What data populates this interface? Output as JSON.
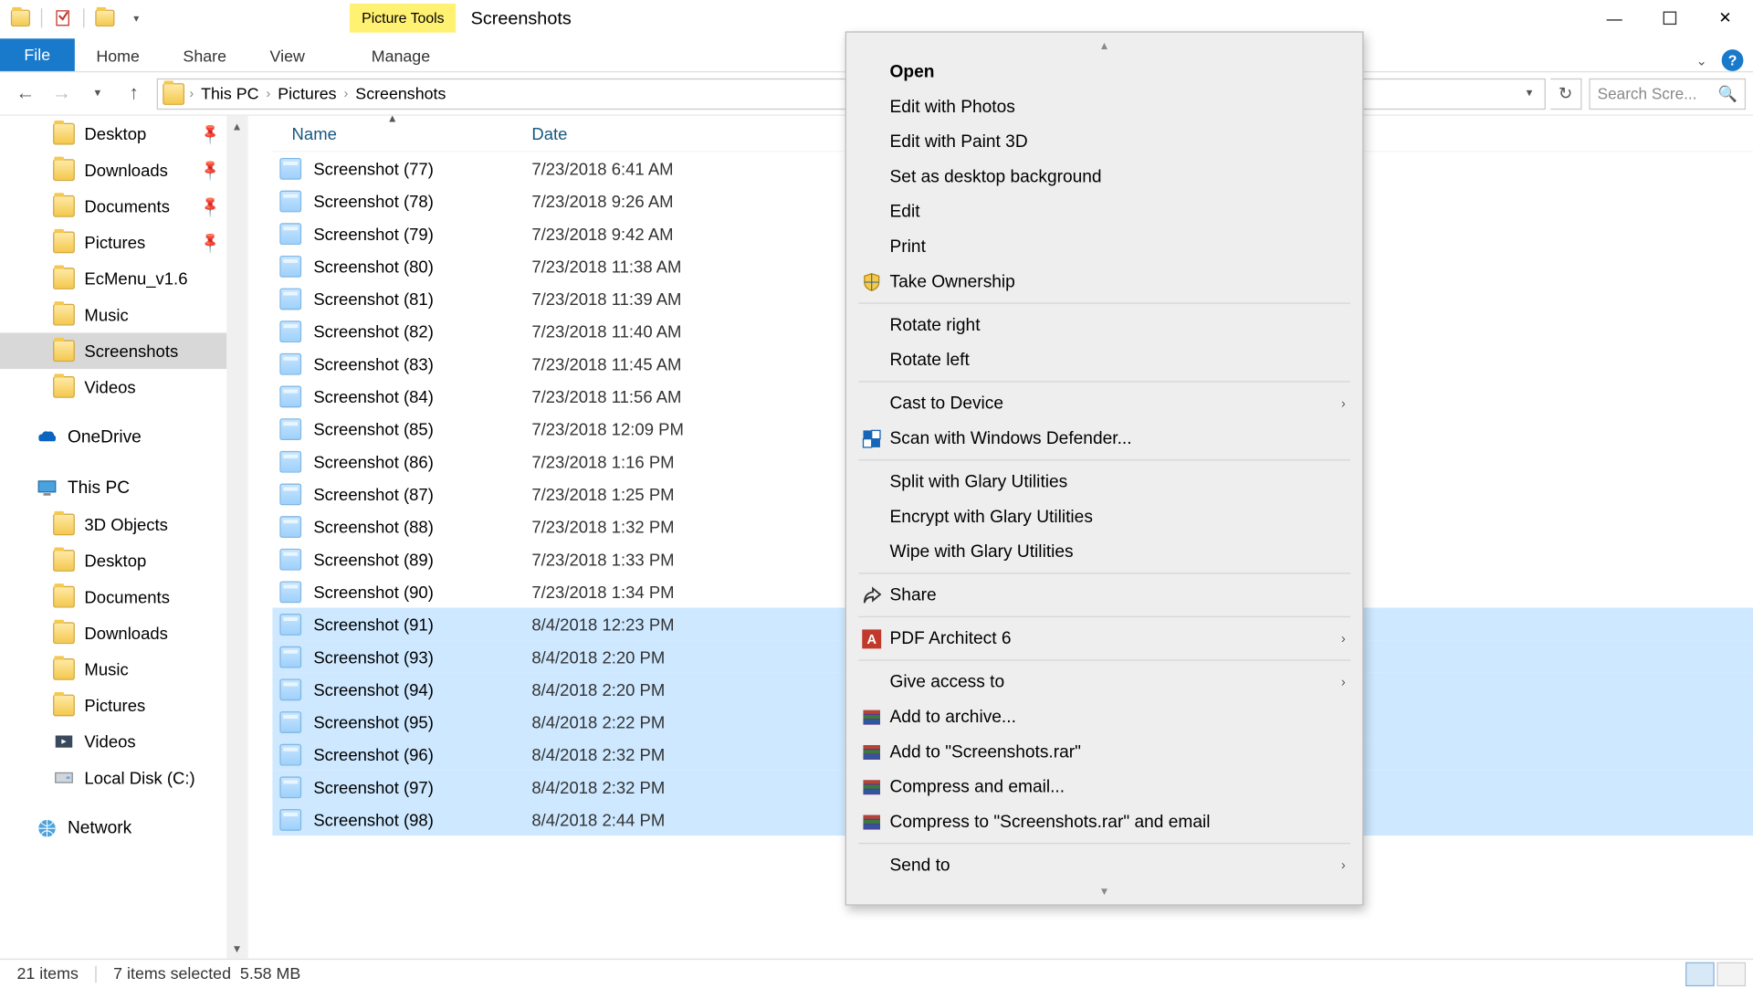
{
  "titlebar": {
    "contextual_tab": "Picture Tools",
    "title": "Screenshots"
  },
  "window_controls": {
    "min": "—",
    "max": "□",
    "close": "✕"
  },
  "ribbon": {
    "file": "File",
    "tabs": [
      "Home",
      "Share",
      "View"
    ],
    "contextual": "Manage"
  },
  "nav": {
    "back": "←",
    "forward": "→",
    "up": "↑",
    "breadcrumbs": [
      "This PC",
      "Pictures",
      "Screenshots"
    ]
  },
  "search": {
    "placeholder": "Search Scre..."
  },
  "sidebar": {
    "quick": [
      {
        "label": "Desktop",
        "pinned": true
      },
      {
        "label": "Downloads",
        "pinned": true
      },
      {
        "label": "Documents",
        "pinned": true
      },
      {
        "label": "Pictures",
        "pinned": true
      },
      {
        "label": "EcMenu_v1.6",
        "pinned": false
      },
      {
        "label": "Music",
        "pinned": false
      },
      {
        "label": "Screenshots",
        "pinned": false,
        "selected": true
      },
      {
        "label": "Videos",
        "pinned": false
      }
    ],
    "onedrive": "OneDrive",
    "thispc": "This PC",
    "thispc_items": [
      "3D Objects",
      "Desktop",
      "Documents",
      "Downloads",
      "Music",
      "Pictures",
      "Videos",
      "Local Disk (C:)"
    ],
    "network": "Network"
  },
  "columns": {
    "name": "Name",
    "date": "Date"
  },
  "files": [
    {
      "name": "Screenshot (77)",
      "date": "7/23/2018 6:41 AM",
      "selected": false
    },
    {
      "name": "Screenshot (78)",
      "date": "7/23/2018 9:26 AM",
      "selected": false
    },
    {
      "name": "Screenshot (79)",
      "date": "7/23/2018 9:42 AM",
      "selected": false
    },
    {
      "name": "Screenshot (80)",
      "date": "7/23/2018 11:38 AM",
      "selected": false
    },
    {
      "name": "Screenshot (81)",
      "date": "7/23/2018 11:39 AM",
      "selected": false
    },
    {
      "name": "Screenshot (82)",
      "date": "7/23/2018 11:40 AM",
      "selected": false
    },
    {
      "name": "Screenshot (83)",
      "date": "7/23/2018 11:45 AM",
      "selected": false
    },
    {
      "name": "Screenshot (84)",
      "date": "7/23/2018 11:56 AM",
      "selected": false
    },
    {
      "name": "Screenshot (85)",
      "date": "7/23/2018 12:09 PM",
      "selected": false
    },
    {
      "name": "Screenshot (86)",
      "date": "7/23/2018 1:16 PM",
      "selected": false
    },
    {
      "name": "Screenshot (87)",
      "date": "7/23/2018 1:25 PM",
      "selected": false
    },
    {
      "name": "Screenshot (88)",
      "date": "7/23/2018 1:32 PM",
      "selected": false
    },
    {
      "name": "Screenshot (89)",
      "date": "7/23/2018 1:33 PM",
      "selected": false
    },
    {
      "name": "Screenshot (90)",
      "date": "7/23/2018 1:34 PM",
      "selected": false
    },
    {
      "name": "Screenshot (91)",
      "date": "8/4/2018 12:23 PM",
      "selected": true
    },
    {
      "name": "Screenshot (93)",
      "date": "8/4/2018 2:20 PM",
      "selected": true
    },
    {
      "name": "Screenshot (94)",
      "date": "8/4/2018 2:20 PM",
      "selected": true
    },
    {
      "name": "Screenshot (95)",
      "date": "8/4/2018 2:22 PM",
      "selected": true
    },
    {
      "name": "Screenshot (96)",
      "date": "8/4/2018 2:32 PM",
      "selected": true
    },
    {
      "name": "Screenshot (97)",
      "date": "8/4/2018 2:32 PM",
      "selected": true
    },
    {
      "name": "Screenshot (98)",
      "date": "8/4/2018 2:44 PM",
      "selected": true
    }
  ],
  "context_menu": [
    {
      "label": "Open",
      "bold": true
    },
    {
      "label": "Edit with Photos"
    },
    {
      "label": "Edit with Paint 3D"
    },
    {
      "label": "Set as desktop background"
    },
    {
      "label": "Edit"
    },
    {
      "label": "Print"
    },
    {
      "label": "Take Ownership",
      "icon": "shield"
    },
    {
      "sep": true
    },
    {
      "label": "Rotate right"
    },
    {
      "label": "Rotate left"
    },
    {
      "sep": true
    },
    {
      "label": "Cast to Device",
      "submenu": true
    },
    {
      "label": "Scan with Windows Defender...",
      "icon": "defender"
    },
    {
      "sep": true
    },
    {
      "label": "Split with Glary Utilities"
    },
    {
      "label": "Encrypt with Glary Utilities"
    },
    {
      "label": "Wipe with Glary Utilities"
    },
    {
      "sep": true
    },
    {
      "label": "Share",
      "icon": "share"
    },
    {
      "sep": true
    },
    {
      "label": "PDF Architect 6",
      "icon": "pdfa",
      "submenu": true
    },
    {
      "sep": true
    },
    {
      "label": "Give access to",
      "submenu": true
    },
    {
      "label": "Add to archive...",
      "icon": "rar"
    },
    {
      "label": "Add to \"Screenshots.rar\"",
      "icon": "rar"
    },
    {
      "label": "Compress and email...",
      "icon": "rar"
    },
    {
      "label": "Compress to \"Screenshots.rar\" and email",
      "icon": "rar"
    },
    {
      "sep": true
    },
    {
      "label": "Send to",
      "submenu": true
    }
  ],
  "status": {
    "items": "21 items",
    "selected": "7 items selected",
    "size": "5.58 MB"
  }
}
